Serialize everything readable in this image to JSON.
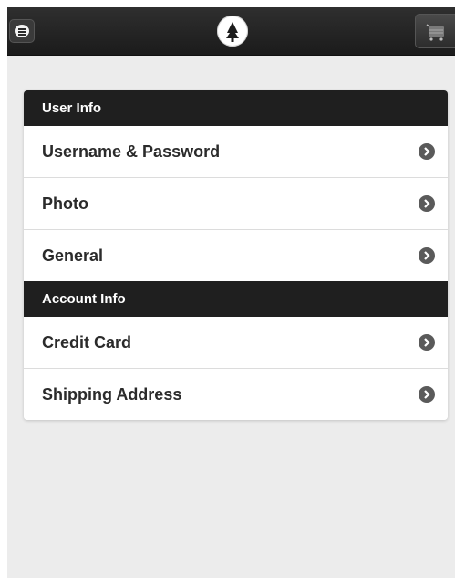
{
  "header": {
    "menu_icon": "menu-icon",
    "logo_icon": "tree-logo-icon",
    "cart_icon": "shopping-cart-icon"
  },
  "sections": [
    {
      "title": "User Info",
      "items": [
        {
          "label": "Username & Password",
          "icon": "chevron-right-icon"
        },
        {
          "label": "Photo",
          "icon": "chevron-right-icon"
        },
        {
          "label": "General",
          "icon": "chevron-right-icon"
        }
      ]
    },
    {
      "title": "Account Info",
      "items": [
        {
          "label": "Credit Card",
          "icon": "chevron-right-icon"
        },
        {
          "label": "Shipping Address",
          "icon": "chevron-right-icon"
        }
      ]
    }
  ],
  "colors": {
    "header_bg": "#1b1b1b",
    "divider_bg": "#1f1f1f",
    "page_bg": "#ececec",
    "arrow": "#5a5a5a"
  }
}
